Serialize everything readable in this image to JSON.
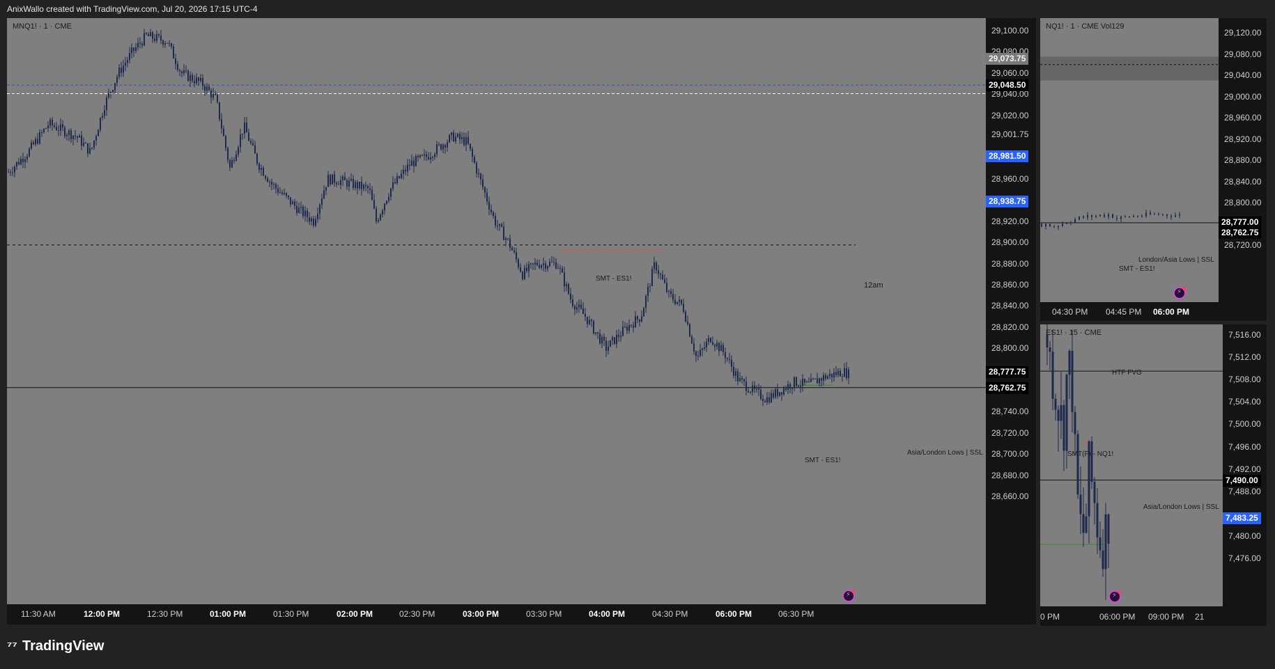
{
  "header": {
    "attribution": "AnixWallo created with TradingView.com, Jul 20, 2026 17:15 UTC-4"
  },
  "footer": {
    "brand": "TradingView"
  },
  "colors": {
    "plot_bg": "#7f7f7f",
    "panel_bg": "#141414",
    "candle": "#1d2a4d",
    "blue_badge": "#2962ff",
    "smt_red": "#e05050",
    "fvg_zone": "#666666"
  },
  "main": {
    "legend": "MNQ1! · 1 · CME",
    "y_ticks": [
      "29,100.00",
      "29,080.00",
      "29,060.00",
      "29,040.00",
      "29,020.00",
      "29,001.75",
      "28,960.00",
      "28,920.00",
      "28,900.00",
      "28,880.00",
      "28,860.00",
      "28,840.00",
      "28,820.00",
      "28,800.00",
      "28,740.00",
      "28,720.00",
      "28,700.00",
      "28,680.00",
      "28,660.00"
    ],
    "price_badges": [
      {
        "value": "29,073.75",
        "style": "plain"
      },
      {
        "value": "29,048.50",
        "style": "dark"
      },
      {
        "value": "28,981.50",
        "style": "blue"
      },
      {
        "value": "28,938.75",
        "style": "blue"
      },
      {
        "value": "28,777.75",
        "style": "dark"
      },
      {
        "value": "28,762.75",
        "style": "dark"
      }
    ],
    "x_ticks": [
      {
        "label": "11:30 AM",
        "bold": false
      },
      {
        "label": "12:00 PM",
        "bold": true
      },
      {
        "label": "12:30 PM",
        "bold": false
      },
      {
        "label": "01:00 PM",
        "bold": true
      },
      {
        "label": "01:30 PM",
        "bold": false
      },
      {
        "label": "02:00 PM",
        "bold": true
      },
      {
        "label": "02:30 PM",
        "bold": false
      },
      {
        "label": "03:00 PM",
        "bold": true
      },
      {
        "label": "03:30 PM",
        "bold": false
      },
      {
        "label": "04:00 PM",
        "bold": true
      },
      {
        "label": "04:30 PM",
        "bold": false
      },
      {
        "label": "06:00 PM",
        "bold": true
      },
      {
        "label": "06:30 PM",
        "bold": false
      }
    ],
    "annotations": {
      "smt_top": "SMT - ES1!",
      "midnight": "12am",
      "ssl": "Asia/London Lows | SSL",
      "smt_bottom": "SMT - ES1!"
    }
  },
  "nq_panel": {
    "legend": "NQ1! · 1 · CME  Vol129",
    "y_ticks": [
      "29,120.00",
      "29,080.00",
      "29,040.00",
      "29,000.00",
      "28,960.00",
      "28,920.00",
      "28,880.00",
      "28,840.00",
      "28,800.00",
      "28,720.00"
    ],
    "price_badges": [
      {
        "value": "28,777.00",
        "style": "dark"
      },
      {
        "value": "28,762.75",
        "style": "dark"
      }
    ],
    "x_ticks": [
      {
        "label": "04:30 PM",
        "bold": false
      },
      {
        "label": "04:45 PM",
        "bold": false
      },
      {
        "label": "06:00 PM",
        "bold": true
      }
    ],
    "annotations": {
      "ssl": "London/Asia Lows | SSL",
      "smt": "SMT - ES1!"
    }
  },
  "es_panel": {
    "legend": "ES1! · 15 · CME",
    "y_ticks": [
      "7,516.00",
      "7,512.00",
      "7,508.00",
      "7,504.00",
      "7,500.00",
      "7,496.00",
      "7,492.00",
      "7,488.00",
      "7,480.00",
      "7,476.00"
    ],
    "price_badges": [
      {
        "value": "7,490.00",
        "style": "dark"
      },
      {
        "value": "7,483.25",
        "style": "blue"
      }
    ],
    "x_ticks": [
      {
        "label": "0 PM",
        "bold": false
      },
      {
        "label": "06:00 PM",
        "bold": false
      },
      {
        "label": "09:00 PM",
        "bold": false
      },
      {
        "label": "21",
        "bold": false
      }
    ],
    "annotations": {
      "fvg": "HTF FVG",
      "smt": "SMT(F) - NQ1!",
      "ssl": "Asia/London Lows | SSL"
    }
  }
}
